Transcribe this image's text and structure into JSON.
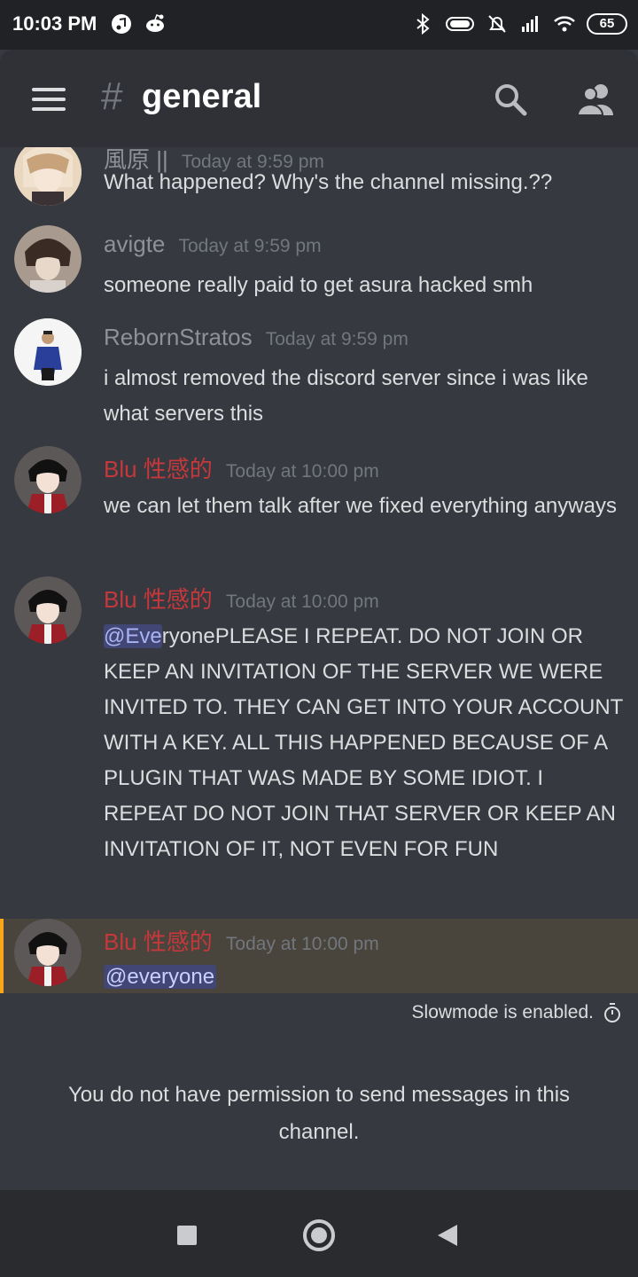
{
  "status_bar": {
    "time": "10:03 PM",
    "battery": "65",
    "icons": [
      "music-app-icon",
      "reddit-icon",
      "bluetooth-icon",
      "vibrate-icon",
      "silent-bell-icon",
      "signal-icon",
      "wifi-icon",
      "battery-icon"
    ]
  },
  "header": {
    "hash": "#",
    "channel_name": "general",
    "icons": [
      "menu-icon",
      "search-icon",
      "members-icon"
    ]
  },
  "messages": [
    {
      "author": "風原 ||",
      "timestamp": "Today at 9:59 pm",
      "text": "What happened? Why's the channel missing.??",
      "author_color": "#8e9297"
    },
    {
      "author": "avigte",
      "timestamp": "Today at 9:59 pm",
      "text": "someone really paid to get asura hacked smh",
      "author_color": "#8e9297"
    },
    {
      "author": "RebornStratos",
      "timestamp": "Today at 9:59 pm",
      "text": "i almost removed the discord server since i was like what servers this",
      "author_color": "#8e9297"
    },
    {
      "author": "Blu 性感的",
      "timestamp": "Today at 10:00 pm",
      "text": "we can let them talk after we fixed everything anyways",
      "author_color": "#c5383b"
    },
    {
      "author": "Blu 性感的",
      "timestamp": "Today at 10:00 pm",
      "mention_highlighted": "@Eve",
      "mention_rest": "ryone",
      "text": "PLEASE I REPEAT. DO NOT JOIN OR KEEP AN INVITATION OF THE SERVER WE WERE INVITED TO. THEY CAN GET INTO YOUR ACCOUNT WITH A KEY. ALL THIS HAPPENED BECAUSE OF A PLUGIN THAT WAS MADE BY SOME IDIOT. I REPEAT DO NOT JOIN THAT SERVER OR KEEP AN INVITATION OF IT, NOT EVEN FOR FUN",
      "author_color": "#c5383b"
    },
    {
      "author": "Blu 性感的",
      "timestamp": "Today at 10:00 pm",
      "mention": "@everyone",
      "author_color": "#c5383b",
      "highlight_color": "#49443c",
      "highlight_bar": "#faa61a"
    }
  ],
  "slowmode_text": "Slowmode is enabled.",
  "no_permission_text": "You do not have permission to send messages in this channel.",
  "nav_bar": {
    "icons": [
      "recent-apps-icon",
      "home-icon",
      "back-icon"
    ]
  },
  "colors": {
    "background": "#36393f",
    "header": "#2f3136",
    "mention_bg": "#414675",
    "mention_fg": "#aab4f3"
  }
}
